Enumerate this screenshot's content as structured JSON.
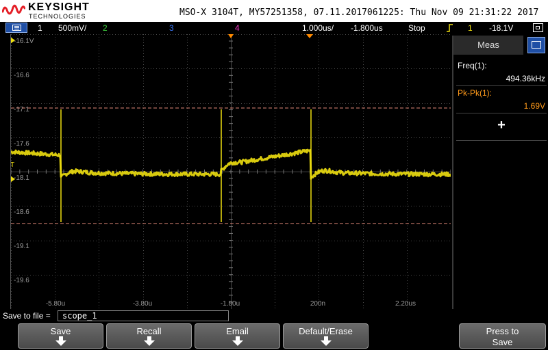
{
  "header": {
    "brand": "KEYSIGHT",
    "brand_sub": "TECHNOLOGIES",
    "title": "MSO-X 3104T, MY57251358, 07.11.2017061225: Thu Nov 09 21:31:22 2017"
  },
  "status": {
    "ch1_num": "1",
    "ch1_scale": "500mV/",
    "ch2_num": "2",
    "ch3_num": "3",
    "ch4_num": "4",
    "timebase": "1.000us/",
    "delay": "-1.800us",
    "run_state": "Stop",
    "trigger_channel": "1",
    "trigger_level": "-18.1V"
  },
  "plot": {
    "y_labels": [
      "-16.1V",
      "-16.6",
      "-17.1",
      "-17.6",
      "-18.1",
      "-18.6",
      "-19.1",
      "-19.6"
    ],
    "x_labels": [
      "-5.80u",
      "-3.80u",
      "-1.80u",
      "200n",
      "2.20us"
    ],
    "ground_marker": "T",
    "colors": {
      "trace": "#f0e010",
      "cursor": "#e58a7a",
      "grid": "#4a4a4a",
      "marker": "#ff8a00"
    }
  },
  "meas": {
    "tab_label": "Meas",
    "items": [
      {
        "label": "Freq(1):",
        "value": "494.36kHz",
        "color": "#ffffff"
      },
      {
        "label": "Pk-Pk(1):",
        "value": "1.69V",
        "color": "#ff9a1a"
      }
    ],
    "add_label": "+"
  },
  "file": {
    "label": "Save to file =",
    "value": "scope_1"
  },
  "softkeys": [
    "Save",
    "Recall",
    "Email",
    "Default/Erase"
  ],
  "press_to_save": [
    "Press to",
    "Save"
  ]
}
